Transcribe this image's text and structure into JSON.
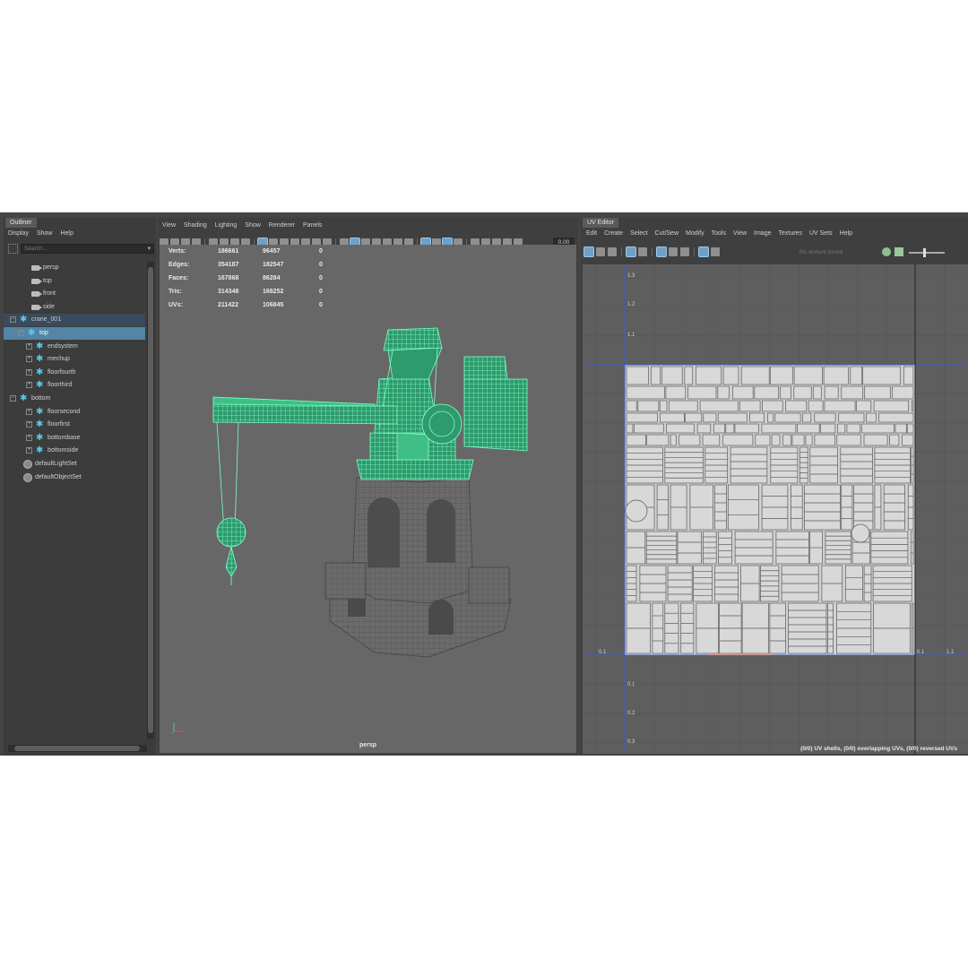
{
  "outliner": {
    "tab": "Outliner",
    "menu": [
      "Display",
      "Show",
      "Help"
    ],
    "search_placeholder": "Search...",
    "items": [
      {
        "label": "persp",
        "icon": "camera-icon"
      },
      {
        "label": "top",
        "icon": "camera-icon"
      },
      {
        "label": "front",
        "icon": "camera-icon"
      },
      {
        "label": "side",
        "icon": "camera-icon"
      },
      {
        "label": "crane_001",
        "icon": "transform-group-icon",
        "expander": "−"
      },
      {
        "label": "top",
        "icon": "transform-group-icon",
        "expander": "−",
        "selected": true
      },
      {
        "label": "endsystem",
        "icon": "transform-group-icon",
        "expander": "+"
      },
      {
        "label": "mechup",
        "icon": "transform-group-icon",
        "expander": "+"
      },
      {
        "label": "floorfourth",
        "icon": "transform-group-icon",
        "expander": "+"
      },
      {
        "label": "floorthird",
        "icon": "transform-group-icon",
        "expander": "+"
      },
      {
        "label": "bottom",
        "icon": "transform-group-icon",
        "expander": "−"
      },
      {
        "label": "floorsecond",
        "icon": "transform-group-icon",
        "expander": "+"
      },
      {
        "label": "floorfirst",
        "icon": "transform-group-icon",
        "expander": "+"
      },
      {
        "label": "bottombase",
        "icon": "transform-group-icon",
        "expander": "+"
      },
      {
        "label": "bottomside",
        "icon": "transform-group-icon",
        "expander": "+"
      },
      {
        "label": "defaultLightSet",
        "icon": "set-icon"
      },
      {
        "label": "defaultObjectSet",
        "icon": "set-icon"
      }
    ]
  },
  "viewport": {
    "menu": [
      "View",
      "Shading",
      "Lighting",
      "Show",
      "Renderer",
      "Panels"
    ],
    "field_value": "0.00",
    "camera_label": "persp",
    "hud": [
      {
        "label": "Verts:",
        "a": "186661",
        "b": "96457",
        "c": "0"
      },
      {
        "label": "Edges:",
        "a": "354187",
        "b": "182547",
        "c": "0"
      },
      {
        "label": "Faces:",
        "a": "167868",
        "b": "86284",
        "c": "0"
      },
      {
        "label": "Tris:",
        "a": "314348",
        "b": "168252",
        "c": "0"
      },
      {
        "label": "UVs:",
        "a": "211422",
        "b": "106845",
        "c": "0"
      }
    ],
    "colors": {
      "selection": "#5cf0a8",
      "mesh": "#6b6b6b",
      "background": "#676767"
    }
  },
  "uv_editor": {
    "tab": "UV Editor",
    "menu": [
      "Edit",
      "Create",
      "Select",
      "Cut/Sew",
      "Modify",
      "Tools",
      "View",
      "Image",
      "Textures",
      "UV Sets",
      "Help"
    ],
    "texture_field": "No texture found",
    "ticks_v": [
      "1.3",
      "1.2",
      "1.1",
      "0.1",
      "0.2",
      "0.3"
    ],
    "ticks_u": [
      "0.1",
      "0.1",
      "1.1"
    ],
    "status": "(0/0) UV shells, (0/0) overlapping UVs, (0/0) reversed UVs"
  }
}
